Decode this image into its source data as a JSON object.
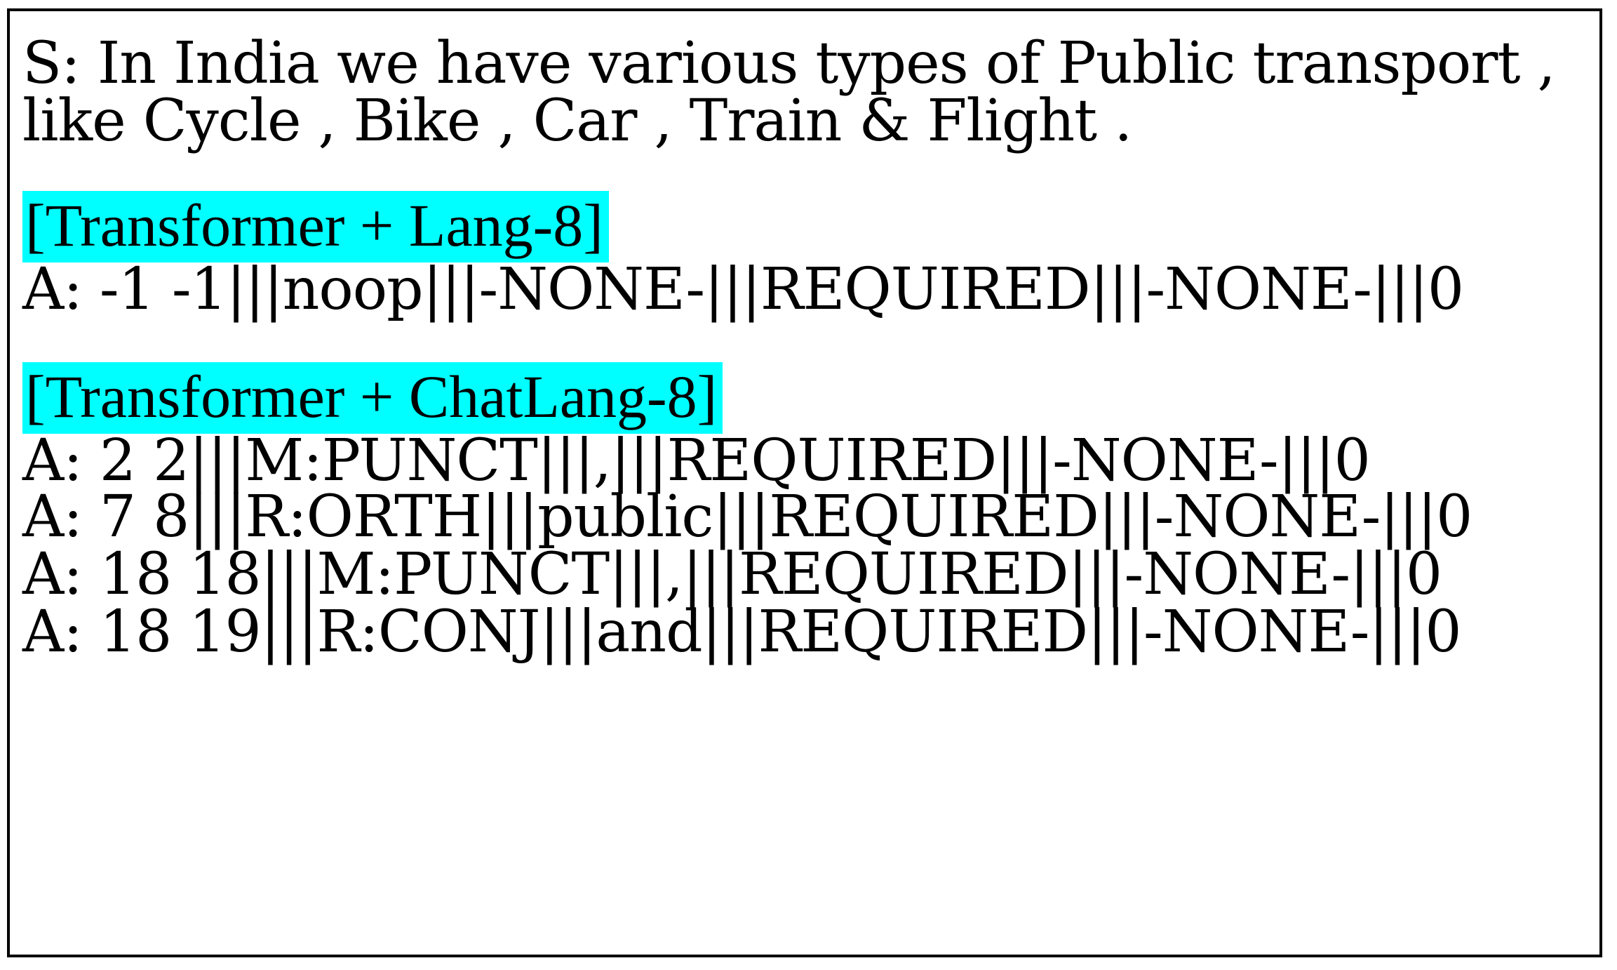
{
  "source": {
    "line1": "S: In India we have various types of Public transport ,",
    "line2": "like Cycle , Bike , Car , Train & Flight ."
  },
  "systems": [
    {
      "label": "[Transformer + Lang-8]",
      "edits": [
        "A: -1 -1|||noop|||-NONE-|||REQUIRED|||-NONE-|||0"
      ]
    },
    {
      "label": "[Transformer + ChatLang-8]",
      "edits": [
        "A: 2 2|||M:PUNCT|||,|||REQUIRED|||-NONE-|||0",
        "A: 7 8|||R:ORTH|||public|||REQUIRED|||-NONE-|||0",
        "A: 18 18|||M:PUNCT|||,|||REQUIRED|||-NONE-|||0",
        "A: 18 19|||R:CONJ|||and|||REQUIRED|||-NONE-|||0"
      ]
    }
  ],
  "colors": {
    "highlight": "#00FFFF",
    "text": "#000000",
    "border": "#000000"
  }
}
